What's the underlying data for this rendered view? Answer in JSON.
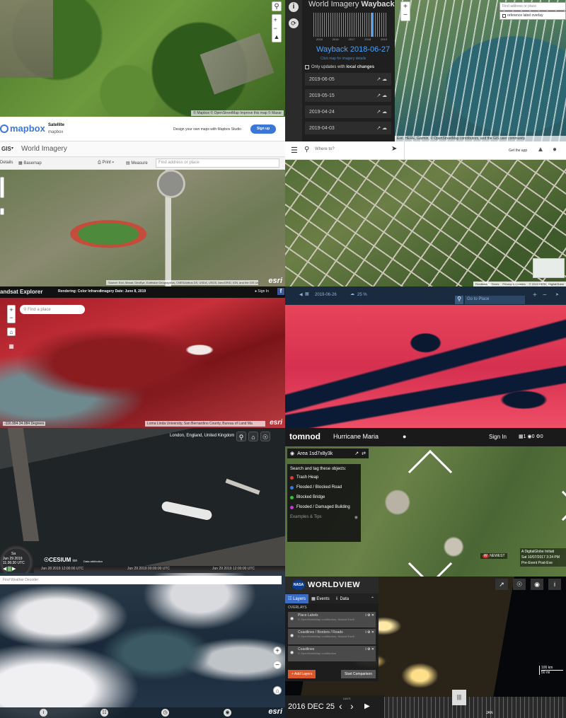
{
  "p1": {
    "attribution": "© Mapbox © OpenStreetMap Improve this map © Maxar"
  },
  "p2": {
    "title_plain": "World Imagery ",
    "title_bold": "Wayback",
    "years": [
      "2015",
      "2016",
      "2017",
      "2018",
      "2019"
    ],
    "date": "Wayback 2018-06-27",
    "hint": "Click map for imagery details",
    "checkbox_label_plain": "Only updates with ",
    "checkbox_label_bold": "local changes",
    "releases": [
      "2019-06-05",
      "2019-05-15",
      "2019-04-24",
      "2019-04-03"
    ]
  },
  "p3": {
    "search_placeholder": "Find address or place",
    "overlay_label": "reference label overlay",
    "attribution": "Esri, HERE, Garmin, © OpenStreetMap contributors, and the GIS user community"
  },
  "p4": {
    "brand": "mapbox",
    "style_name": "Satellite",
    "style_sub": "mapbox",
    "promo": "Design your own maps with Mapbox Studio",
    "signup": "Sign up",
    "gis_label": "GIS",
    "map_title": "World Imagery",
    "details": "Details",
    "basemap": "Basemap",
    "print": "Print",
    "measure": "Measure",
    "search_placeholder": "Find address or place",
    "attribution": "Source: Esri, Maxar, GeoEye, Earthstar Geographics, CNES/Airbus DS, USDA, USGS, AeroGRID, IGN, and the GIS User Community",
    "esri": "esri"
  },
  "p5": {
    "search_placeholder": "Where to?",
    "get_app": "Get the app",
    "footer": [
      "Feedback",
      "Terms",
      "Privacy & Cookies",
      "© 2019 HERE, DigitalGlobe"
    ]
  },
  "p6": {
    "app_name": "andsat Explorer",
    "rendering_label": "Rendering: ",
    "rendering_value": "Color Infrared",
    "date_label": "Imagery Date: ",
    "date_value": "June 8, 2019",
    "signin": "Sign In",
    "search_placeholder": "Find a place",
    "coords": "-116.994 34.084 Degrees",
    "attribution": "Loma Linda University, San Bernardino County, Bureau of Land Ma",
    "esri": "esri"
  },
  "p7": {
    "date": "2019-06-26",
    "cloud": "25 %",
    "goto": "Go to Place"
  },
  "p8": {
    "location": "London, England, United Kingdom",
    "clock_day": "Sa",
    "clock_date": "Jun 29 2019",
    "clock_time": "11:36:30 UTC",
    "cesium": "CESIUM",
    "cesium_sub": "ion",
    "timeline": [
      "Jun 28 2019 12:00:00 UTC",
      "Jun 29 2019 00:00:00 UTC",
      "Jun 29 2019 12:00:00 UTC"
    ],
    "data_attribution": "Data attribution"
  },
  "p9": {
    "brand": "tomnod",
    "project": "Hurricane Maria",
    "signin": "Sign In",
    "stats": [
      "1",
      "0",
      "0"
    ],
    "area": "Area 1sd7x8y3k",
    "instructions": "Search and tag these objects:",
    "tags": [
      {
        "label": "Trash Heap",
        "color": "#e23a3a"
      },
      {
        "label": "Flooded / Blocked Road",
        "color": "#3a7ae2"
      },
      {
        "label": "Blocked Bridge",
        "color": "#2ec43a"
      },
      {
        "label": "Flooded / Damaged Building",
        "color": "#c43ad6"
      }
    ],
    "examples": "Examples & Tips",
    "newest": "NEWEST",
    "attribution_lines": [
      "A DigitalGlobe Initiati",
      "Sat 10/07/2017 3:24 PM",
      "Pre-Event",
      "Post-Eve"
    ]
  },
  "p10": {
    "search_placeholder": "Find Weather Decoder",
    "esri": "esri"
  },
  "p11": {
    "brand": "WORLDVIEW",
    "nasa": "NASA",
    "tabs": [
      "Layers",
      "Events",
      "Data"
    ],
    "section": "OVERLAYS",
    "layers": [
      {
        "name": "Place Labels",
        "sub": "© OpenStreetMap contributors, Natural Earth"
      },
      {
        "name": "Coastlines / Borders / Roads",
        "sub": "© OpenStreetMap contributors, Natural Earth"
      },
      {
        "name": "Coastlines",
        "sub": "© OpenStreetMap contributors"
      }
    ],
    "add_layers": "+ Add Layers",
    "compare": "Start Comparison",
    "date": "2016 DEC 25",
    "days": "DAYS",
    "scale": [
      "100 km",
      "50 mi"
    ],
    "month": "JAN"
  }
}
